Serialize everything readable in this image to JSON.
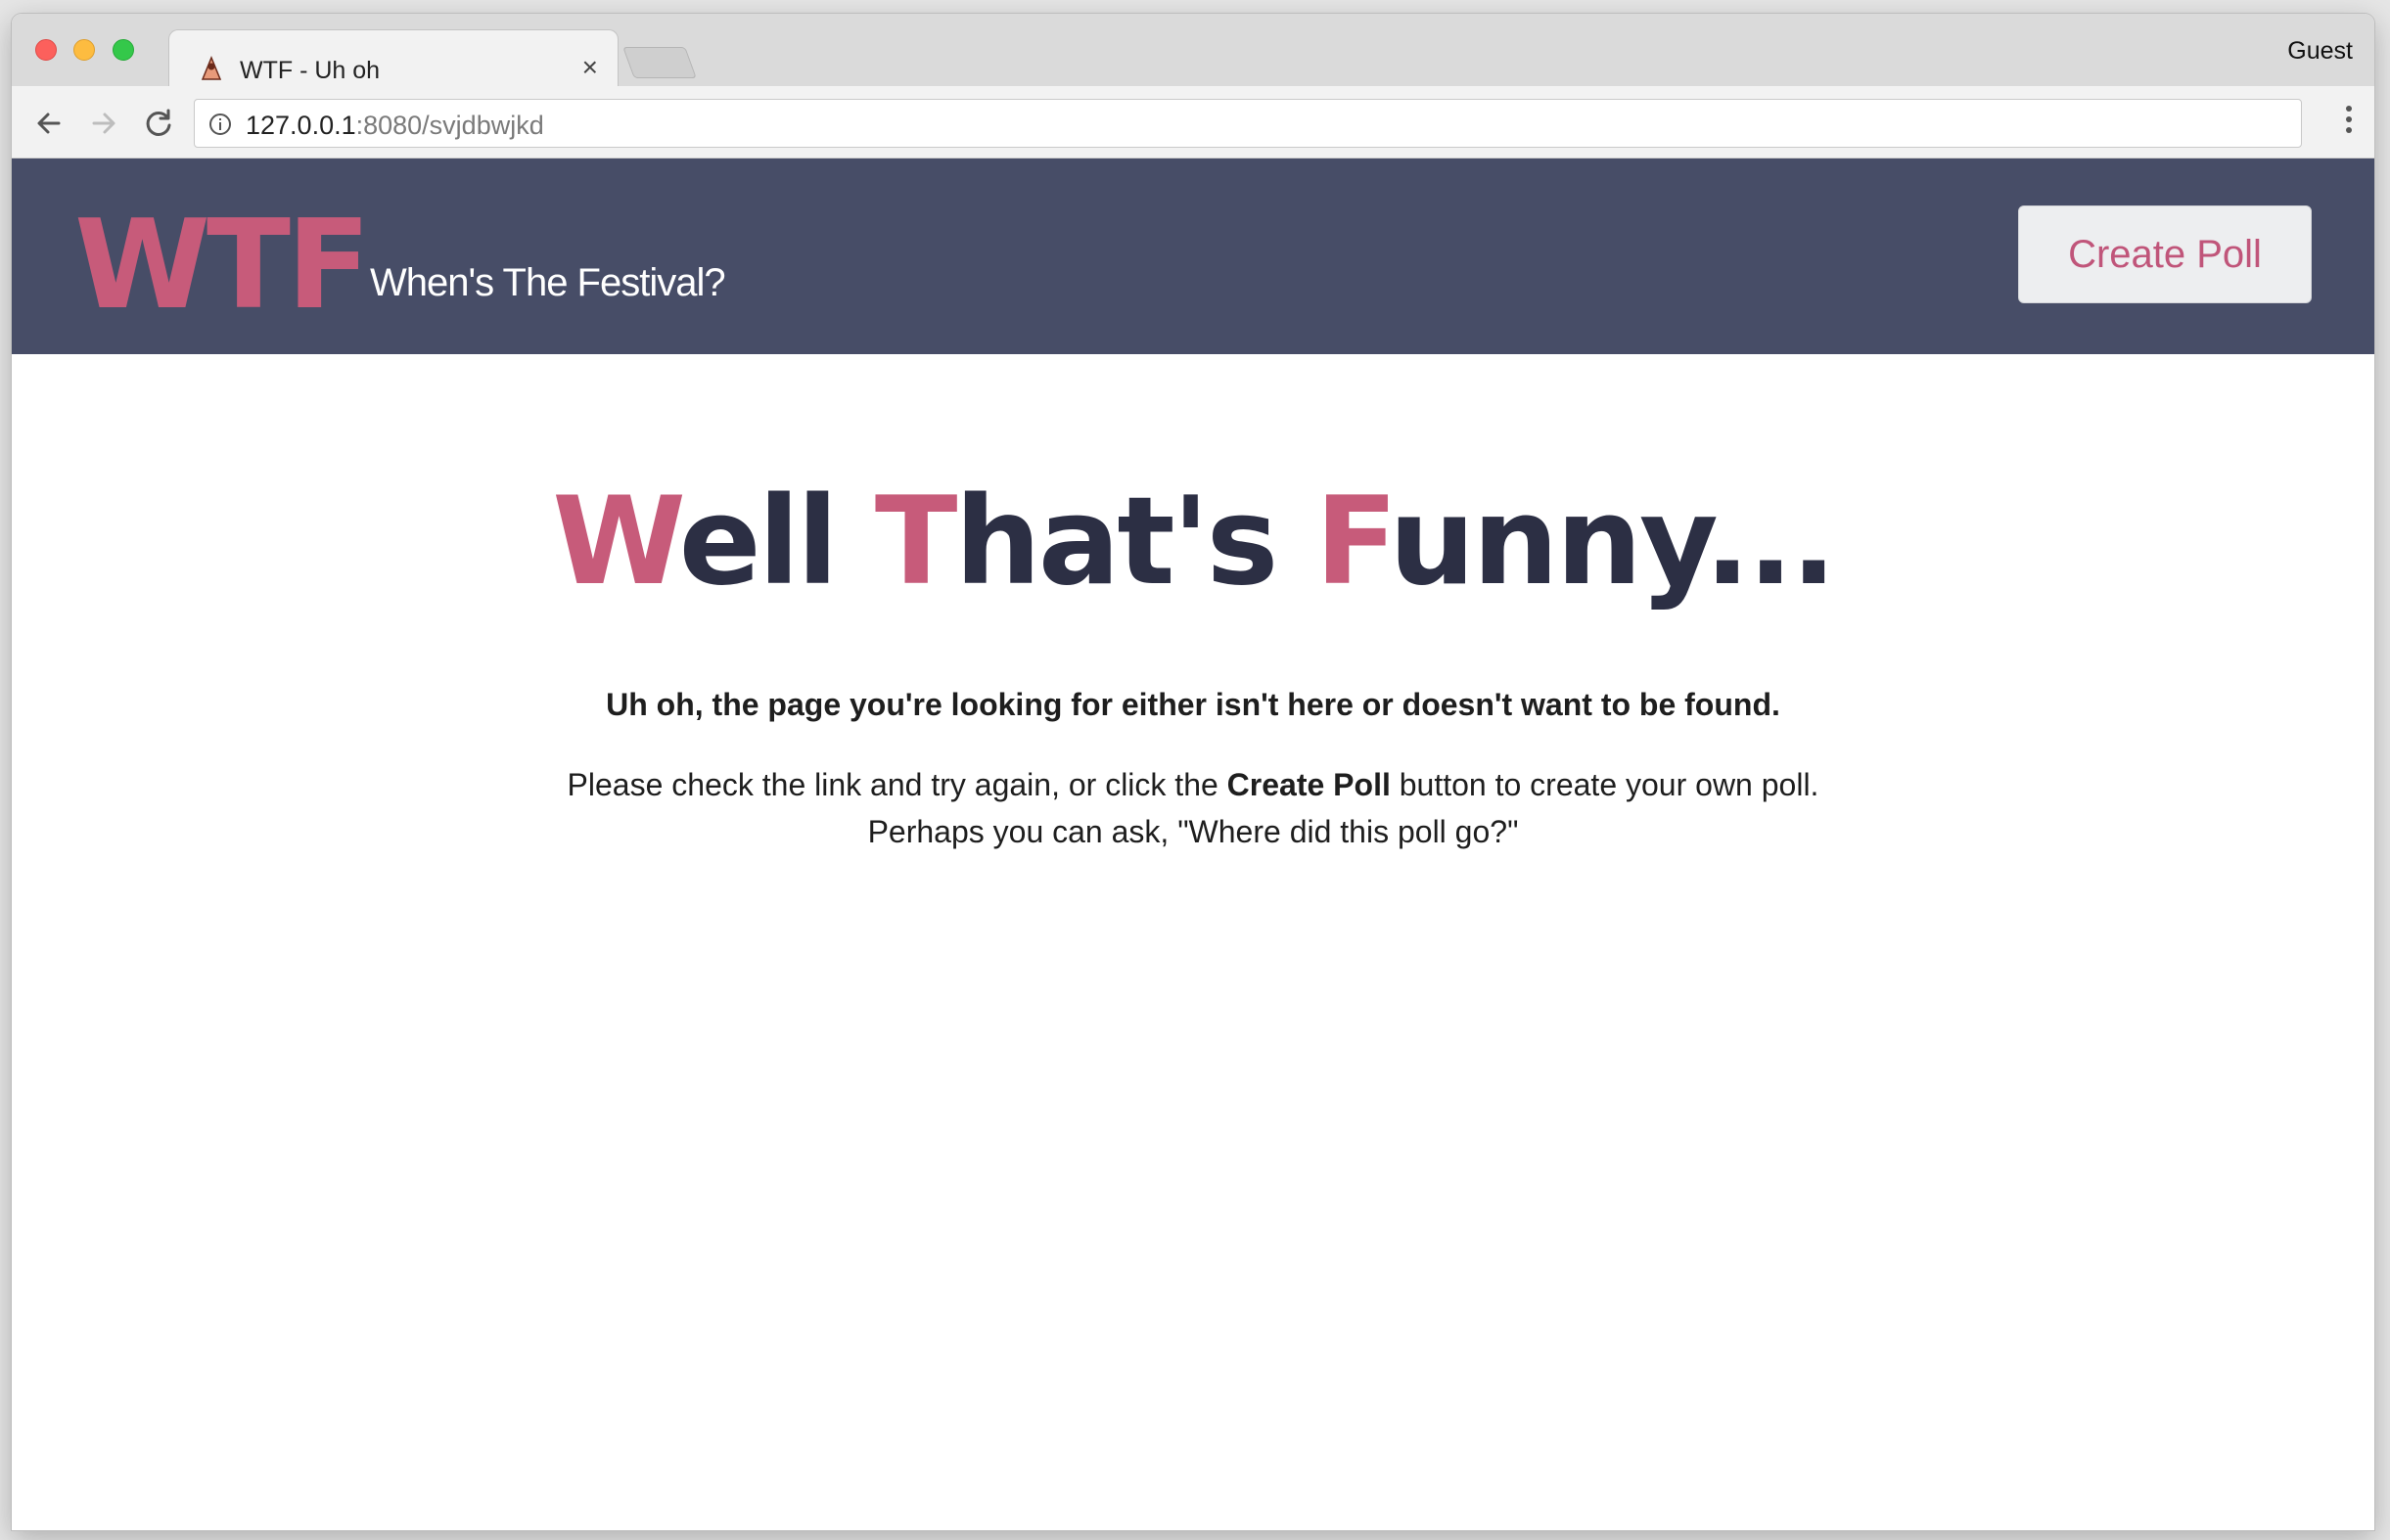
{
  "browser": {
    "tab_title": "WTF - Uh oh",
    "tab_close": "×",
    "profile": "Guest",
    "url_host": "127.0.0.1",
    "url_rest": ":8080/svjdbwjkd"
  },
  "header": {
    "logo": "WTF",
    "tagline": "When's The Festival?",
    "create_poll": "Create Poll"
  },
  "main": {
    "heading_w": "W",
    "heading_ell": "ell ",
    "heading_t": "T",
    "heading_hats": "hat's ",
    "heading_f": "F",
    "heading_unny": "unny...",
    "subheading": "Uh oh, the page you're looking for either isn't here or doesn't want to be found.",
    "line1_pre": "Please check the link and try again, or click the ",
    "line1_bold": "Create Poll",
    "line1_post": " button to create your own poll.",
    "line2": "Perhaps you can ask, \"Where did this poll go?\""
  },
  "colors": {
    "header_bg": "#474d67",
    "accent": "#c75b7a",
    "heading_dark": "#2c2f44"
  }
}
